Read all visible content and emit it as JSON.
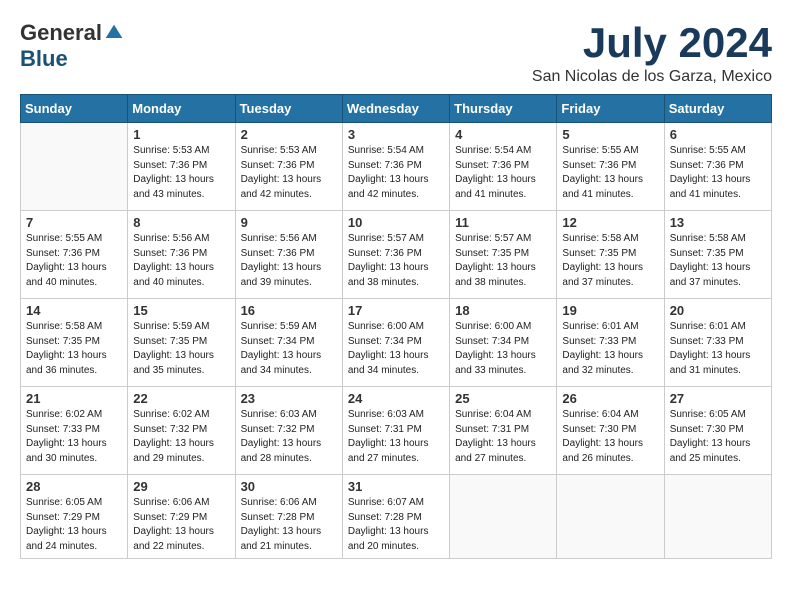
{
  "logo": {
    "general": "General",
    "blue": "Blue"
  },
  "title": "July 2024",
  "subtitle": "San Nicolas de los Garza, Mexico",
  "days_header": [
    "Sunday",
    "Monday",
    "Tuesday",
    "Wednesday",
    "Thursday",
    "Friday",
    "Saturday"
  ],
  "weeks": [
    [
      {
        "num": "",
        "info": ""
      },
      {
        "num": "1",
        "info": "Sunrise: 5:53 AM\nSunset: 7:36 PM\nDaylight: 13 hours\nand 43 minutes."
      },
      {
        "num": "2",
        "info": "Sunrise: 5:53 AM\nSunset: 7:36 PM\nDaylight: 13 hours\nand 42 minutes."
      },
      {
        "num": "3",
        "info": "Sunrise: 5:54 AM\nSunset: 7:36 PM\nDaylight: 13 hours\nand 42 minutes."
      },
      {
        "num": "4",
        "info": "Sunrise: 5:54 AM\nSunset: 7:36 PM\nDaylight: 13 hours\nand 41 minutes."
      },
      {
        "num": "5",
        "info": "Sunrise: 5:55 AM\nSunset: 7:36 PM\nDaylight: 13 hours\nand 41 minutes."
      },
      {
        "num": "6",
        "info": "Sunrise: 5:55 AM\nSunset: 7:36 PM\nDaylight: 13 hours\nand 41 minutes."
      }
    ],
    [
      {
        "num": "7",
        "info": "Sunrise: 5:55 AM\nSunset: 7:36 PM\nDaylight: 13 hours\nand 40 minutes."
      },
      {
        "num": "8",
        "info": "Sunrise: 5:56 AM\nSunset: 7:36 PM\nDaylight: 13 hours\nand 40 minutes."
      },
      {
        "num": "9",
        "info": "Sunrise: 5:56 AM\nSunset: 7:36 PM\nDaylight: 13 hours\nand 39 minutes."
      },
      {
        "num": "10",
        "info": "Sunrise: 5:57 AM\nSunset: 7:36 PM\nDaylight: 13 hours\nand 38 minutes."
      },
      {
        "num": "11",
        "info": "Sunrise: 5:57 AM\nSunset: 7:35 PM\nDaylight: 13 hours\nand 38 minutes."
      },
      {
        "num": "12",
        "info": "Sunrise: 5:58 AM\nSunset: 7:35 PM\nDaylight: 13 hours\nand 37 minutes."
      },
      {
        "num": "13",
        "info": "Sunrise: 5:58 AM\nSunset: 7:35 PM\nDaylight: 13 hours\nand 37 minutes."
      }
    ],
    [
      {
        "num": "14",
        "info": "Sunrise: 5:58 AM\nSunset: 7:35 PM\nDaylight: 13 hours\nand 36 minutes."
      },
      {
        "num": "15",
        "info": "Sunrise: 5:59 AM\nSunset: 7:35 PM\nDaylight: 13 hours\nand 35 minutes."
      },
      {
        "num": "16",
        "info": "Sunrise: 5:59 AM\nSunset: 7:34 PM\nDaylight: 13 hours\nand 34 minutes."
      },
      {
        "num": "17",
        "info": "Sunrise: 6:00 AM\nSunset: 7:34 PM\nDaylight: 13 hours\nand 34 minutes."
      },
      {
        "num": "18",
        "info": "Sunrise: 6:00 AM\nSunset: 7:34 PM\nDaylight: 13 hours\nand 33 minutes."
      },
      {
        "num": "19",
        "info": "Sunrise: 6:01 AM\nSunset: 7:33 PM\nDaylight: 13 hours\nand 32 minutes."
      },
      {
        "num": "20",
        "info": "Sunrise: 6:01 AM\nSunset: 7:33 PM\nDaylight: 13 hours\nand 31 minutes."
      }
    ],
    [
      {
        "num": "21",
        "info": "Sunrise: 6:02 AM\nSunset: 7:33 PM\nDaylight: 13 hours\nand 30 minutes."
      },
      {
        "num": "22",
        "info": "Sunrise: 6:02 AM\nSunset: 7:32 PM\nDaylight: 13 hours\nand 29 minutes."
      },
      {
        "num": "23",
        "info": "Sunrise: 6:03 AM\nSunset: 7:32 PM\nDaylight: 13 hours\nand 28 minutes."
      },
      {
        "num": "24",
        "info": "Sunrise: 6:03 AM\nSunset: 7:31 PM\nDaylight: 13 hours\nand 27 minutes."
      },
      {
        "num": "25",
        "info": "Sunrise: 6:04 AM\nSunset: 7:31 PM\nDaylight: 13 hours\nand 27 minutes."
      },
      {
        "num": "26",
        "info": "Sunrise: 6:04 AM\nSunset: 7:30 PM\nDaylight: 13 hours\nand 26 minutes."
      },
      {
        "num": "27",
        "info": "Sunrise: 6:05 AM\nSunset: 7:30 PM\nDaylight: 13 hours\nand 25 minutes."
      }
    ],
    [
      {
        "num": "28",
        "info": "Sunrise: 6:05 AM\nSunset: 7:29 PM\nDaylight: 13 hours\nand 24 minutes."
      },
      {
        "num": "29",
        "info": "Sunrise: 6:06 AM\nSunset: 7:29 PM\nDaylight: 13 hours\nand 22 minutes."
      },
      {
        "num": "30",
        "info": "Sunrise: 6:06 AM\nSunset: 7:28 PM\nDaylight: 13 hours\nand 21 minutes."
      },
      {
        "num": "31",
        "info": "Sunrise: 6:07 AM\nSunset: 7:28 PM\nDaylight: 13 hours\nand 20 minutes."
      },
      {
        "num": "",
        "info": ""
      },
      {
        "num": "",
        "info": ""
      },
      {
        "num": "",
        "info": ""
      }
    ]
  ]
}
